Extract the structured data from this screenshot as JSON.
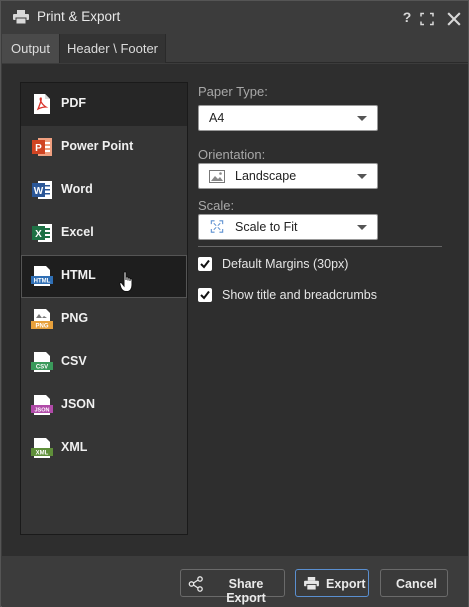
{
  "window": {
    "title": "Print & Export",
    "help_glyph": "?",
    "icons": [
      "printer-icon",
      "help-icon",
      "maximize-icon",
      "close-icon"
    ]
  },
  "tabs": [
    {
      "label": "Output",
      "active": true
    },
    {
      "label": "Header \\ Footer",
      "active": false
    }
  ],
  "formats": [
    {
      "label": "PDF",
      "icon": "pdf-icon",
      "selected": true
    },
    {
      "label": "Power Point",
      "icon": "powerpoint-icon",
      "selected": false
    },
    {
      "label": "Word",
      "icon": "word-icon",
      "selected": false
    },
    {
      "label": "Excel",
      "icon": "excel-icon",
      "selected": false
    },
    {
      "label": "HTML",
      "icon": "html-icon",
      "selected": false,
      "hovered": true,
      "badge": "HTML"
    },
    {
      "label": "PNG",
      "icon": "png-icon",
      "selected": false,
      "badge": "PNG"
    },
    {
      "label": "CSV",
      "icon": "csv-icon",
      "selected": false,
      "badge": "CSV"
    },
    {
      "label": "JSON",
      "icon": "json-icon",
      "selected": false,
      "badge": "JSON"
    },
    {
      "label": "XML",
      "icon": "xml-icon",
      "selected": false,
      "badge": "XML"
    }
  ],
  "options": {
    "paper_type": {
      "label": "Paper Type:",
      "value": "A4"
    },
    "orientation": {
      "label": "Orientation:",
      "value": "Landscape",
      "icon": "landscape-icon"
    },
    "scale": {
      "label": "Scale:",
      "value": "Scale to Fit",
      "icon": "scale-to-fit-icon"
    },
    "default_margins": {
      "label": "Default Margins (30px)",
      "checked": true
    },
    "show_title": {
      "label": "Show title and breadcrumbs",
      "checked": true
    }
  },
  "footer": {
    "share_label": "Share Export",
    "export_label": "Export",
    "cancel_label": "Cancel"
  },
  "colors": {
    "accent": "#5a8fd0",
    "pdf": "#d9342b",
    "powerpoint": "#d04423",
    "word": "#2b5797",
    "excel": "#1e7145",
    "html": "#2f6fb5",
    "png": "#e8a13c",
    "csv": "#3a9a5b",
    "json": "#b04aa8",
    "xml": "#5f8f3a"
  }
}
